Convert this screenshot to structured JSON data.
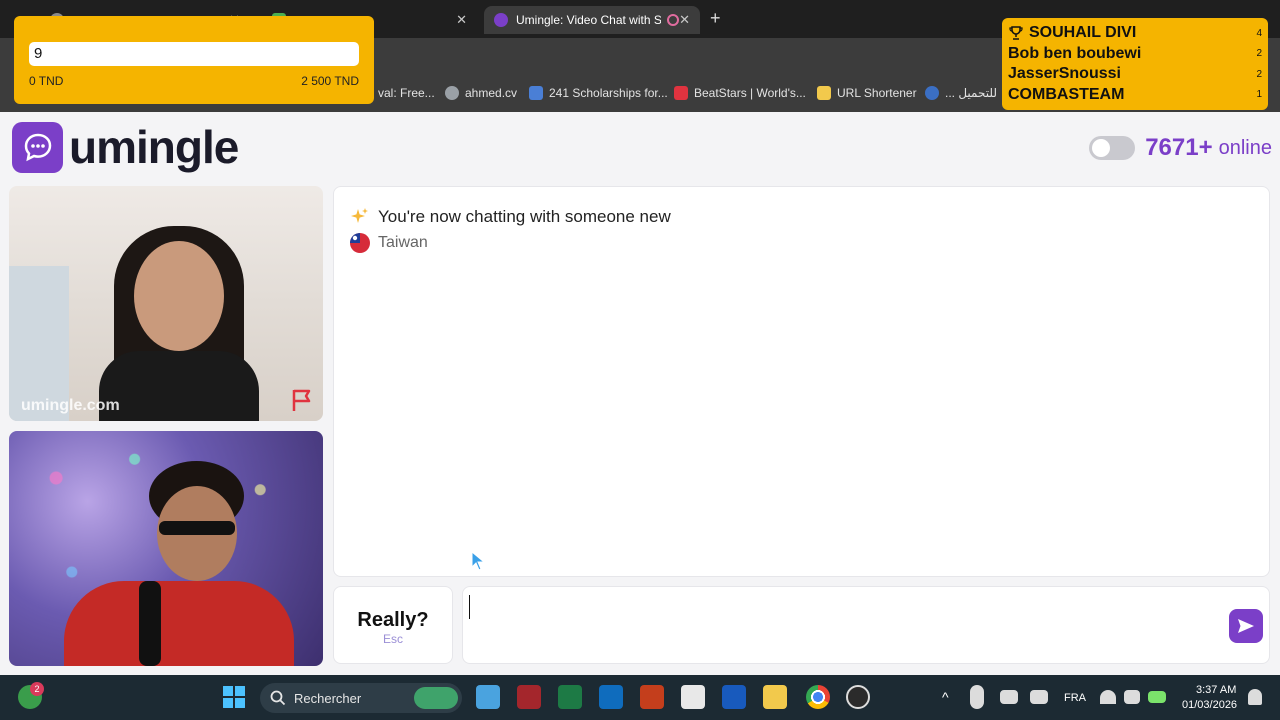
{
  "browser": {
    "tabs": [
      {
        "label": "",
        "active": false
      },
      {
        "label": "",
        "active": false
      },
      {
        "label": "Umingle: Video Chat with S",
        "active": true
      }
    ],
    "bookmarks": [
      {
        "label": "val: Free...",
        "icon": "bookmark-icon"
      },
      {
        "label": "ahmed.cv",
        "icon": "globe-icon"
      },
      {
        "label": "241 Scholarships for...",
        "icon": "scholarship-icon"
      },
      {
        "label": "BeatStars | World's...",
        "icon": "beatstars-icon"
      },
      {
        "label": "URL Shortener",
        "icon": "folder-icon"
      },
      {
        "label": "... للتحميل",
        "icon": "gear-icon"
      }
    ]
  },
  "goal_overlay": {
    "value": "9",
    "min_label": "0 TND",
    "max_label": "2 500 TND"
  },
  "leaderboard": [
    {
      "name": "SOUHAIL DIVI",
      "score": "4"
    },
    {
      "name": "Bob ben boubewi",
      "score": "2"
    },
    {
      "name": "JasserSnoussi",
      "score": "2"
    },
    {
      "name": "COMBASTEAM",
      "score": "1"
    }
  ],
  "site": {
    "logo_text": "umingle",
    "online_count": "7671+",
    "online_label": "online"
  },
  "stranger_video": {
    "watermark": "umingle.com"
  },
  "chat": {
    "system_message": "You're now chatting with someone new",
    "country": "Taiwan"
  },
  "skip_button": {
    "label": "Really?",
    "key": "Esc"
  },
  "message_input": {
    "value": "",
    "placeholder": ""
  },
  "taskbar": {
    "notification_count": "2",
    "search_label": "Rechercher",
    "language": "FRA",
    "time": "3:37 AM",
    "date": "01/03/2026"
  },
  "colors": {
    "brand": "#7b3fc8",
    "overlay": "#f5b400"
  }
}
